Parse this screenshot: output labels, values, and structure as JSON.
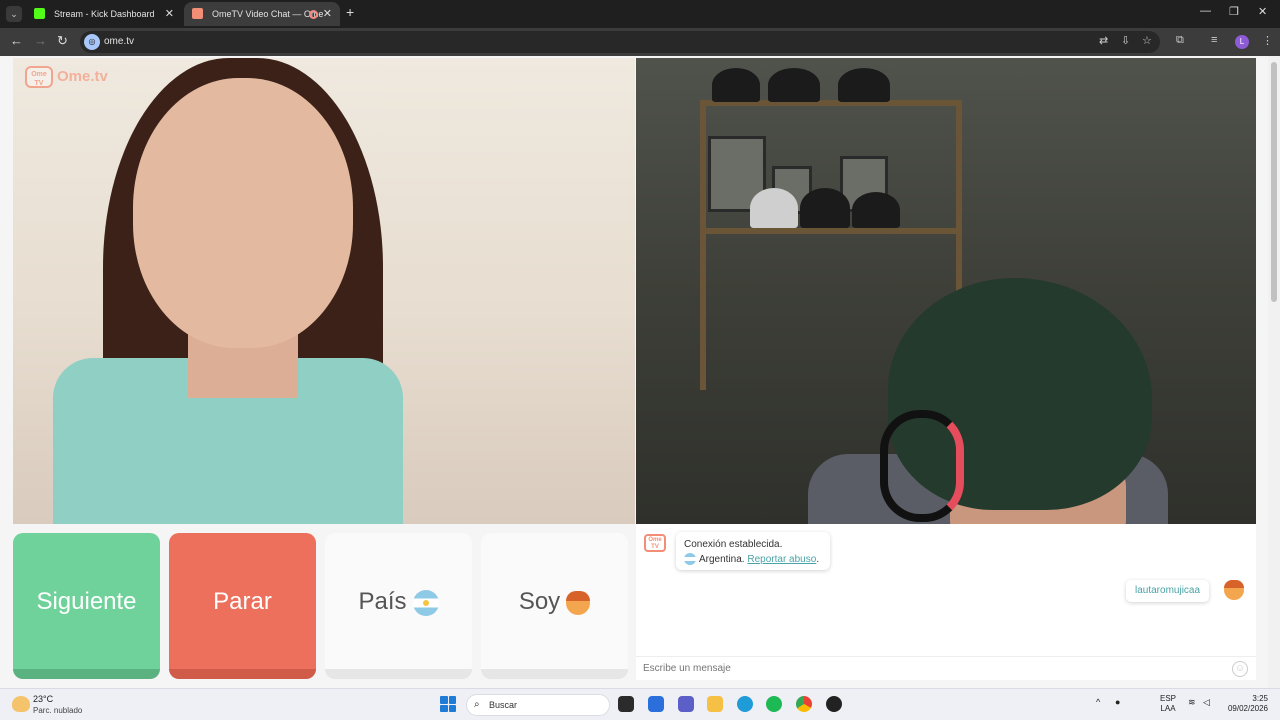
{
  "browser": {
    "tabs": [
      {
        "label": "Stream - Kick Dashboard",
        "active": false
      },
      {
        "label": "OmeTV Video Chat — Ome",
        "active": true
      }
    ],
    "url": "ome.tv"
  },
  "site": {
    "logo_tv": "Ome TV",
    "logo_text": "Ome.tv"
  },
  "controls": {
    "next_label": "Siguiente",
    "stop_label": "Parar",
    "country_label": "País",
    "gender_label": "Soy"
  },
  "chat": {
    "system_line1": "Conexión establecida.",
    "country": "Argentina.",
    "report_link": "Reportar abuso",
    "username": "lautaromujicaa",
    "input_placeholder": "Escribe un mensaje"
  },
  "taskbar": {
    "temperature": "23°C",
    "weather": "Parc. nublado",
    "search_label": "Buscar",
    "lang_line1": "ESP",
    "lang_line2": "LAA",
    "time": "3:25",
    "date": "09/02/2026"
  },
  "colors": {
    "next": "#6fd29a",
    "stop": "#ec705c",
    "accent": "#4aa3a6",
    "logo": "#f3b19c"
  }
}
